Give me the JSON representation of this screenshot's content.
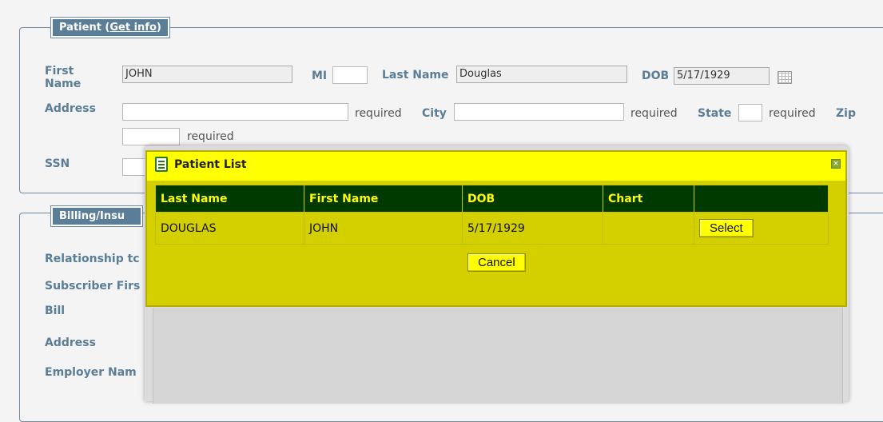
{
  "patient": {
    "legend": "Patient (",
    "get_info": "Get info",
    "legend_end": ")",
    "first_name_label_1": "First",
    "first_name_label_2": "Name",
    "first_name_value": "JOHN",
    "mi_label": "MI",
    "last_name_label": "Last Name",
    "last_name_value": "Douglas",
    "dob_label": "DOB",
    "dob_value": "5/17/1929",
    "address_label": "Address",
    "required": "required",
    "city_label": "City",
    "state_label": "State",
    "zip_label": "Zip",
    "ssn_label": "SSN"
  },
  "billing": {
    "legend": "Billing/Insu",
    "relationship_label": "Relationship tc",
    "subscriber_first_label": "Subscriber Firs",
    "bill_label": "Bill",
    "address_label": "Address",
    "employer_label": "Employer Nam"
  },
  "dialog": {
    "title": "Patient List",
    "close_glyph": "×",
    "columns": [
      "Last Name",
      "First Name",
      "DOB",
      "Chart",
      ""
    ],
    "rows": [
      {
        "last_name": "DOUGLAS",
        "first_name": "JOHN",
        "dob": "5/17/1929",
        "chart": "",
        "action": "Select"
      }
    ],
    "cancel_label": "Cancel"
  },
  "colors": {
    "accent": "#5a7d98",
    "dialog_title_bg": "#ffff00",
    "dialog_body_bg": "#d4d000",
    "table_header_bg": "#003a00",
    "table_header_text": "#ffff00"
  }
}
